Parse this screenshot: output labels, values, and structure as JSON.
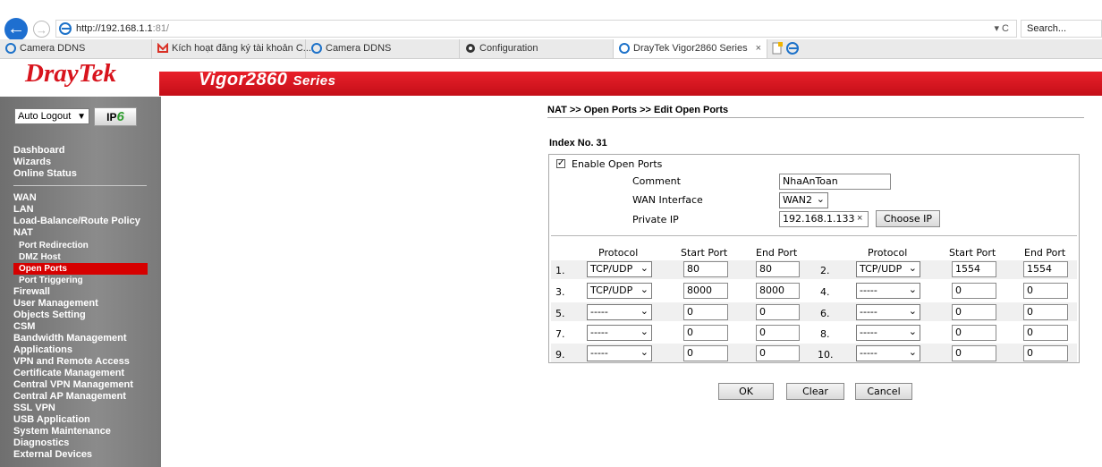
{
  "browser": {
    "url_host": "http://192.168.1.1",
    "url_rest": ":81/",
    "url_controls": "▾ C",
    "search_placeholder": "Search...",
    "tabs": [
      {
        "label": "Camera DDNS"
      },
      {
        "label": "Kích hoạt đăng ký tài khoản C..."
      },
      {
        "label": "Camera DDNS"
      },
      {
        "label": "Configuration"
      },
      {
        "label": "DrayTek Vigor2860 Series"
      }
    ]
  },
  "brand": {
    "logo": "DrayTek",
    "product_name": "Vigor2860",
    "product_series": "Series"
  },
  "sidebar": {
    "auto_logout": "Auto Logout",
    "ipv6_ip": "IP",
    "ipv6_six": "6",
    "group1": [
      "Dashboard",
      "Wizards",
      "Online Status"
    ],
    "group2": [
      "WAN",
      "LAN",
      "Load-Balance/Route Policy",
      "NAT"
    ],
    "nat_sub": [
      "Port Redirection",
      "DMZ Host",
      "Open Ports",
      "Port Triggering"
    ],
    "group3": [
      "Firewall",
      "User Management",
      "Objects Setting",
      "CSM",
      "Bandwidth Management",
      "Applications",
      "VPN and Remote Access",
      "Certificate Management",
      "Central VPN Management",
      "Central AP Management",
      "SSL VPN",
      "USB Application",
      "System Maintenance",
      "Diagnostics",
      "External Devices"
    ]
  },
  "main": {
    "breadcrumb": "NAT >> Open Ports >> Edit Open Ports",
    "index_label": "Index No. 31",
    "enable_label": "Enable Open Ports",
    "enable_checked": "✓",
    "comment_label": "Comment",
    "comment_value": "NhaAnToan",
    "wan_label": "WAN Interface",
    "wan_value": "WAN2",
    "private_ip_label": "Private IP",
    "private_ip_value": "192.168.1.133",
    "choose_ip": "Choose IP",
    "col_protocol": "Protocol",
    "col_start": "Start Port",
    "col_end": "End Port",
    "rows": [
      {
        "n": "1.",
        "proto": "TCP/UDP",
        "start": "80",
        "end": "80"
      },
      {
        "n": "2.",
        "proto": "TCP/UDP",
        "start": "1554",
        "end": "1554"
      },
      {
        "n": "3.",
        "proto": "TCP/UDP",
        "start": "8000",
        "end": "8000"
      },
      {
        "n": "4.",
        "proto": "-----",
        "start": "0",
        "end": "0"
      },
      {
        "n": "5.",
        "proto": "-----",
        "start": "0",
        "end": "0"
      },
      {
        "n": "6.",
        "proto": "-----",
        "start": "0",
        "end": "0"
      },
      {
        "n": "7.",
        "proto": "-----",
        "start": "0",
        "end": "0"
      },
      {
        "n": "8.",
        "proto": "-----",
        "start": "0",
        "end": "0"
      },
      {
        "n": "9.",
        "proto": "-----",
        "start": "0",
        "end": "0"
      },
      {
        "n": "10.",
        "proto": "-----",
        "start": "0",
        "end": "0"
      }
    ],
    "ok": "OK",
    "clear": "Clear",
    "cancel": "Cancel"
  }
}
